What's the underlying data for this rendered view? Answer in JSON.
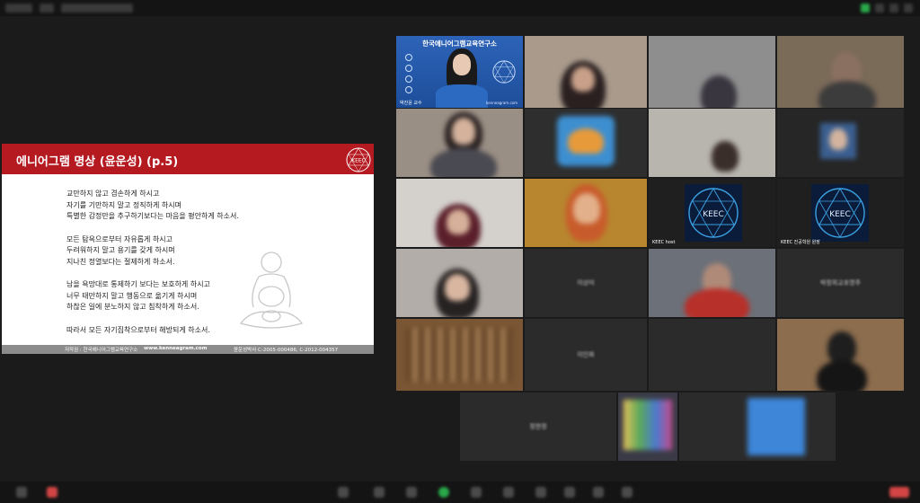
{
  "slide": {
    "title": "에니어그램 명상 (윤운성) (p.5)",
    "logo_text": "KEEC",
    "paragraphs": [
      [
        "교만하지 않고 겸손하게 하시고",
        "자기를 기만하지 말고 정직하게 하시며",
        "특별한 감정만을 추구하기보다는 마음을 평안하게 하소서."
      ],
      [
        "모든 탐욕으로부터 자유롭게 하시고",
        "두려워하지 말고 용기를 갖게 하시며",
        "지나친 정열보다는 절제하게 하소서."
      ],
      [
        "남을 욕망대로 통제하기 보다는 보호하게 하시고",
        "너무 태만하지 말고 행동으로 옮기게 하시며",
        "하찮은 일에 분노하지 않고 침착하게 하소서."
      ],
      [
        "따라서 모든 자기집착으로부터 해방되게 하소서."
      ]
    ],
    "footer_copyright": "저작권 : 한국에니어그램교육연구소",
    "footer_url": "www.kenneagram.com",
    "footer_reg": "윤운성박사 C-2005-000486, C-2012-004357"
  },
  "host": {
    "title": "한국에니어그램교육연구소",
    "name": "박진윤 교수",
    "site": "kenneagram.com"
  },
  "tiles": {
    "keec1_name": "KEEC host",
    "keec2_name": "KEEC 진공학원 원장",
    "keec_text": "KEEC",
    "name1": "이상미",
    "name2": "박정희교포영주",
    "name3": "이인화",
    "name4": "정현정"
  },
  "colors": {
    "slide_header": "#b51a20",
    "host_bg": "#2d63b8",
    "keec_bg": "#0b1b3a",
    "keec_line": "#3aa0e0",
    "app_bg": "#1b1b1b"
  }
}
